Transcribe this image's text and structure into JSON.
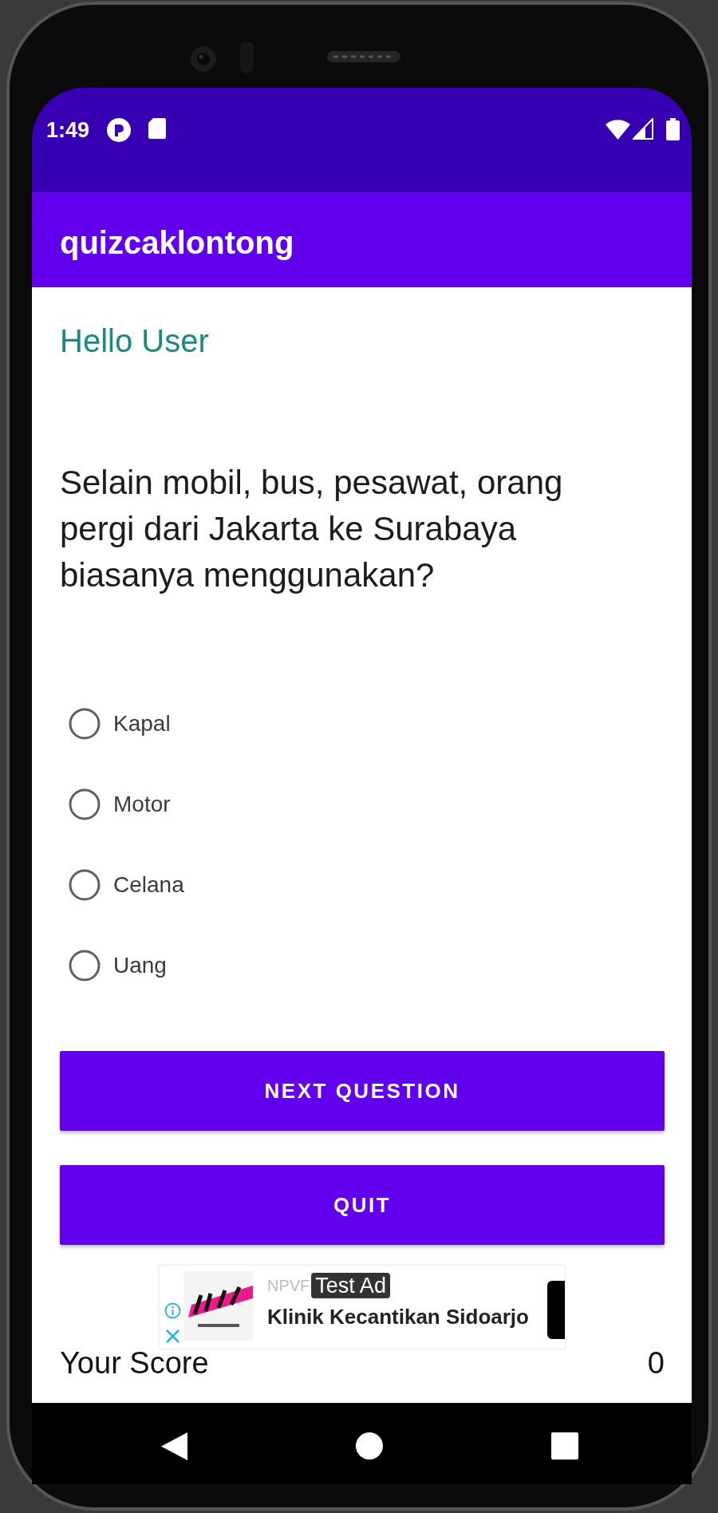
{
  "status_bar": {
    "time": "1:49"
  },
  "app_bar": {
    "title": "quizcaklontong"
  },
  "greeting": "Hello User",
  "question": "Selain mobil, bus, pesawat, orang pergi dari Jakarta ke Surabaya biasanya menggunakan?",
  "options": [
    {
      "label": "Kapal",
      "selected": false
    },
    {
      "label": "Motor",
      "selected": false
    },
    {
      "label": "Celana",
      "selected": false
    },
    {
      "label": "Uang",
      "selected": false
    }
  ],
  "buttons": [
    {
      "label": "NEXT QUESTION"
    },
    {
      "label": "QUIT"
    }
  ],
  "ad": {
    "advertiser": "NPVF",
    "badge": "Test Ad",
    "headline": "Klinik Kecantikan Sidoarjo"
  },
  "score": {
    "label": "Your Score",
    "value": "0"
  }
}
